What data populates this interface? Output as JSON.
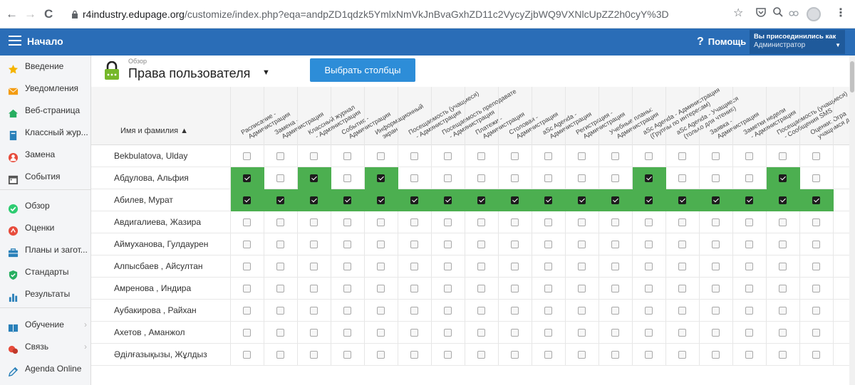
{
  "browser": {
    "back": "←",
    "forward": "→",
    "reload": "C",
    "host": "r4industry.edupage.org",
    "path": "/customize/index.php?eqa=andpZD1qdzk5YmlxNmVkJnBvaGxhZD11c2VycyZjbWQ9VXNlcUpZZ2h0cyY%3D",
    "icons": [
      "star-icon",
      "pocket-icon",
      "search-icon",
      "extension-icon",
      "profile-icon",
      "menu-dots-icon"
    ]
  },
  "topbar": {
    "title": "Начало",
    "help": "Помощь",
    "help_glyph": "?",
    "user_line1": "Вы присоединились как",
    "user_line2": "Администратор"
  },
  "sidebar": {
    "items": [
      {
        "label": "Введение",
        "icon": "star-icon",
        "color": "#f5b400"
      },
      {
        "label": "Уведомления",
        "icon": "envelope-icon",
        "color": "#f39c12"
      },
      {
        "label": "Веб-страница",
        "icon": "home-icon",
        "color": "#27ae60"
      },
      {
        "label": "Классный жур...",
        "icon": "journal-icon",
        "color": "#2980b9"
      },
      {
        "label": "Замена",
        "icon": "person-icon",
        "color": "#e74c3c"
      },
      {
        "label": "События",
        "icon": "calendar-icon",
        "color": "#555555"
      },
      {
        "label": "Обзор",
        "icon": "check-circle-icon",
        "color": "#2ecc71"
      },
      {
        "label": "Оценки",
        "icon": "grade-icon",
        "color": "#e74c3c"
      },
      {
        "label": "Планы и загот...",
        "icon": "briefcase-icon",
        "color": "#2980b9"
      },
      {
        "label": "Стандарты",
        "icon": "shield-check-icon",
        "color": "#27ae60"
      },
      {
        "label": "Результаты",
        "icon": "bar-chart-icon",
        "color": "#2980b9"
      },
      {
        "label": "Обучение",
        "icon": "book-icon",
        "color": "#2980b9"
      },
      {
        "label": "Связь",
        "icon": "chat-icon",
        "color": "#e74c3c"
      },
      {
        "label": "Agenda Online",
        "icon": "pencil-icon",
        "color": "#2980b9"
      }
    ]
  },
  "page": {
    "breadcrumb": "Обзор",
    "title": "Права пользователя",
    "select_columns": "Выбрать столбцы"
  },
  "grid": {
    "name_header": "Имя и фамилия ▲",
    "columns": [
      [
        "Расписание -",
        "Администрация"
      ],
      [
        "Замена -",
        "Администрация"
      ],
      [
        "Классный журнал",
        "- Администрация"
      ],
      [
        "События -",
        "Администрация"
      ],
      [
        "Информационный",
        "экран"
      ],
      [
        "Посещаемость (учащиеся)",
        "- Администрация"
      ],
      [
        "Посещаемость преподавате",
        "- Администрация"
      ],
      [
        "Платежи -",
        "Администрация"
      ],
      [
        "Столовая -",
        "Администрация"
      ],
      [
        "aSc Agenda -",
        "Администрация"
      ],
      [
        "Регистрация -",
        "Администрация"
      ],
      [
        "Учебные планы:",
        "Администрация"
      ],
      [
        "aSc Agenda - Администрация",
        "(Группы по интересам)"
      ],
      [
        "aSc Agenda - Учащиеся",
        "(только для чтения)"
      ],
      [
        "Заявка -",
        "Администрация"
      ],
      [
        "Заметки недели",
        "- Администрация"
      ],
      [
        "Посещаемость (учащиеся)",
        "- Сообщения SMS"
      ],
      [
        "Оценки: Огра",
        "учащимся д"
      ]
    ],
    "rows": [
      {
        "name": "Bekbulatova, Ulday",
        "checked": [
          0,
          0,
          0,
          0,
          0,
          0,
          0,
          0,
          0,
          0,
          0,
          0,
          0,
          0,
          0,
          0,
          0,
          0
        ]
      },
      {
        "name": "Абдулова, Альфия",
        "checked": [
          1,
          0,
          1,
          0,
          1,
          0,
          0,
          0,
          0,
          0,
          0,
          0,
          1,
          0,
          0,
          0,
          1,
          0
        ]
      },
      {
        "name": "Абилев, Мурат",
        "checked": [
          1,
          1,
          1,
          1,
          1,
          1,
          1,
          1,
          1,
          1,
          1,
          1,
          1,
          1,
          1,
          1,
          1,
          1
        ]
      },
      {
        "name": "Авдигалиева, Жазира",
        "checked": [
          0,
          0,
          0,
          0,
          0,
          0,
          0,
          0,
          0,
          0,
          0,
          0,
          0,
          0,
          0,
          0,
          0,
          0
        ]
      },
      {
        "name": "Аймуханова, Гулдаурен",
        "checked": [
          0,
          0,
          0,
          0,
          0,
          0,
          0,
          0,
          0,
          0,
          0,
          0,
          0,
          0,
          0,
          0,
          0,
          0
        ]
      },
      {
        "name": "Алпысбаев , Айсултан",
        "checked": [
          0,
          0,
          0,
          0,
          0,
          0,
          0,
          0,
          0,
          0,
          0,
          0,
          0,
          0,
          0,
          0,
          0,
          0
        ]
      },
      {
        "name": "Амренова , Индира",
        "checked": [
          0,
          0,
          0,
          0,
          0,
          0,
          0,
          0,
          0,
          0,
          0,
          0,
          0,
          0,
          0,
          0,
          0,
          0
        ]
      },
      {
        "name": "Аубакирова , Райхан",
        "checked": [
          0,
          0,
          0,
          0,
          0,
          0,
          0,
          0,
          0,
          0,
          0,
          0,
          0,
          0,
          0,
          0,
          0,
          0
        ]
      },
      {
        "name": "Ахетов , Аманжол",
        "checked": [
          0,
          0,
          0,
          0,
          0,
          0,
          0,
          0,
          0,
          0,
          0,
          0,
          0,
          0,
          0,
          0,
          0,
          0
        ]
      },
      {
        "name": "Әділғазықызы, Жұлдыз",
        "checked": [
          0,
          0,
          0,
          0,
          0,
          0,
          0,
          0,
          0,
          0,
          0,
          0,
          0,
          0,
          0,
          0,
          0,
          0
        ]
      }
    ]
  },
  "colors": {
    "topbar": "#2a6db7",
    "checked_cell": "#4caf50",
    "button": "#2d8dd8"
  }
}
